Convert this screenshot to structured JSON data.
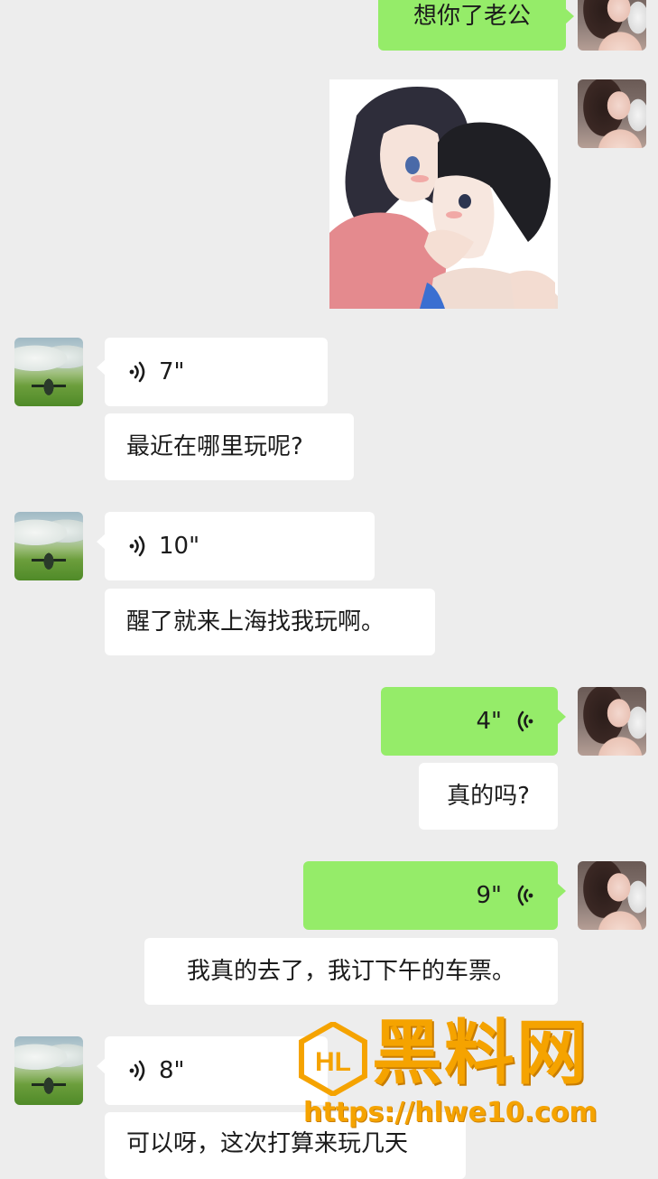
{
  "messages": {
    "m1": {
      "sender": "self",
      "type": "text",
      "text": "想你了老公"
    },
    "m2": {
      "sender": "self",
      "type": "sticker"
    },
    "m3": {
      "sender": "friend",
      "type": "voice",
      "duration": "7\""
    },
    "m4": {
      "sender": "friend",
      "type": "text",
      "text": "最近在哪里玩呢?"
    },
    "m5": {
      "sender": "friend",
      "type": "voice",
      "duration": "10\""
    },
    "m6": {
      "sender": "friend",
      "type": "text",
      "text": "醒了就来上海找我玩啊。"
    },
    "m7": {
      "sender": "self",
      "type": "voice",
      "duration": "4\""
    },
    "m8": {
      "sender": "self",
      "type": "text",
      "text": "真的吗?"
    },
    "m9": {
      "sender": "self",
      "type": "voice",
      "duration": "9\""
    },
    "m10": {
      "sender": "self",
      "type": "text",
      "text": "我真的去了，我订下午的车票。"
    },
    "m11": {
      "sender": "friend",
      "type": "voice",
      "duration": "8\""
    },
    "m12": {
      "sender": "friend",
      "type": "text",
      "text": "可以呀，这次打算来玩几天"
    }
  },
  "watermark": {
    "title": "黑料网",
    "url": "https://hlwe10.com",
    "logo_letters": "HL"
  },
  "colors": {
    "background": "#ededed",
    "outgoing_bubble": "#95ec69",
    "incoming_bubble": "#ffffff",
    "watermark": "#f5a300"
  },
  "icons": {
    "voice_in": "voice-wave-icon",
    "voice_out": "voice-wave-icon"
  }
}
